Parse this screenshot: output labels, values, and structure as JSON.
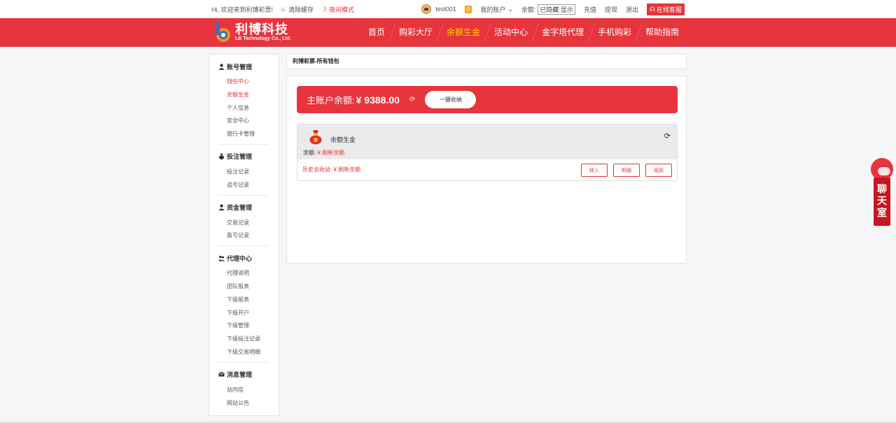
{
  "topbar": {
    "greeting": "Hi, 欢迎来到利博彩票!",
    "clear_cache": "清除缓存",
    "night_mode": "夜间模式",
    "username": "test001",
    "msg_count": "0",
    "my_account": "我的账户",
    "balance_label": "余额:",
    "hidden_toggle": "已隐藏 显示",
    "recharge": "充值",
    "withdraw": "提现",
    "logout": "退出",
    "service": "在线客服"
  },
  "logo": {
    "cn": "利博科技",
    "en": "LB Technology Co., Ltd."
  },
  "nav": [
    "首页",
    "购彩大厅",
    "余额生金",
    "活动中心",
    "金字塔代理",
    "手机购彩",
    "帮助指南"
  ],
  "sidebar": {
    "groups": [
      {
        "title": "账号管理",
        "items": [
          "钱包中心",
          "余额生金",
          "个人信息",
          "安全中心",
          "银行卡管理"
        ]
      },
      {
        "title": "投注管理",
        "items": [
          "投注记录",
          "追号记录"
        ]
      },
      {
        "title": "资金管理",
        "items": [
          "交易记录",
          "盈亏记录"
        ]
      },
      {
        "title": "代理中心",
        "items": [
          "代理说明",
          "团队报表",
          "下级报表",
          "下级开户",
          "下级管理",
          "下级投注记录",
          "下级交易明细"
        ]
      },
      {
        "title": "消息管理",
        "items": [
          "站内信",
          "网站公告"
        ]
      }
    ]
  },
  "breadcrumb": "利博彩票-所有钱包",
  "main": {
    "balance_label": "主账户余额:",
    "balance_amount": "¥ 9388.00",
    "collect_all": "一键收纳",
    "wallet": {
      "name": "余额生金",
      "balance_label": "余额:",
      "balance_value": "¥ 刷新余额",
      "history_label": "历史总收益:",
      "history_value": "¥ 刷新余额",
      "btn_in": "转入",
      "btn_detail": "明细",
      "btn_rule": "规则"
    }
  },
  "chat": {
    "label": "聊天室"
  }
}
